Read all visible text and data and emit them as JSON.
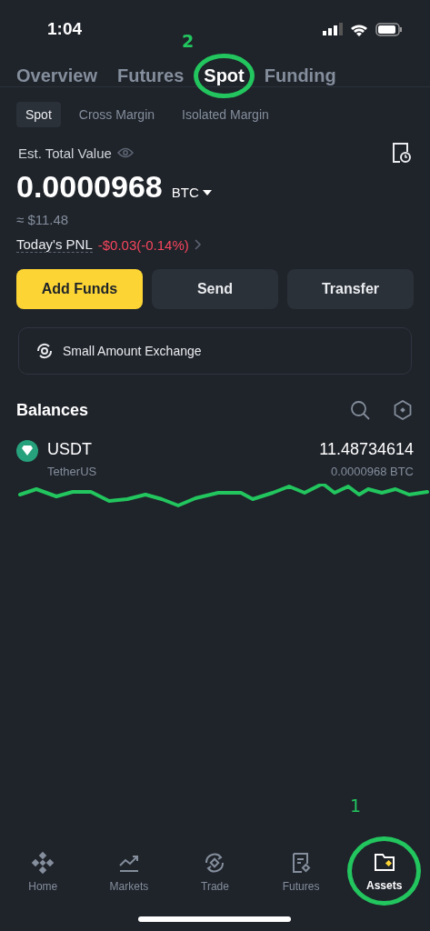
{
  "status_bar": {
    "time": "1:04"
  },
  "tabs": [
    {
      "label": "Overview",
      "selected": false,
      "circled": false
    },
    {
      "label": "Futures",
      "selected": false,
      "circled": false
    },
    {
      "label": "Spot",
      "selected": true,
      "circled": true,
      "note": "2"
    },
    {
      "label": "Funding",
      "selected": false,
      "circled": false
    }
  ],
  "sub_tabs": [
    {
      "label": "Spot",
      "selected": true
    },
    {
      "label": "Cross Margin",
      "selected": false
    },
    {
      "label": "Isolated Margin",
      "selected": false
    }
  ],
  "summary": {
    "label": "Est. Total Value",
    "value": "0.0000968",
    "unit": "BTC",
    "fiat": "≈ $11.48",
    "pnl_label": "Today's PNL",
    "pnl": "-$0.03(-0.14%)"
  },
  "actions": [
    {
      "label": "Add Funds",
      "kind": "primary"
    },
    {
      "label": "Send",
      "kind": "secondary"
    },
    {
      "label": "Transfer",
      "kind": "secondary"
    }
  ],
  "exchange_banner": {
    "label": "Small Amount Exchange"
  },
  "balances": {
    "title": "Balances",
    "assets": [
      {
        "symbol": "USDT",
        "name": "TetherUS",
        "amount": "11.48734614",
        "btc_value": "0.0000968 BTC",
        "underlined": true
      }
    ]
  },
  "bottom_nav": [
    {
      "label": "Home",
      "kind": "home",
      "selected": false,
      "circled": false
    },
    {
      "label": "Markets",
      "kind": "markets",
      "selected": false,
      "circled": false
    },
    {
      "label": "Trade",
      "kind": "trade",
      "selected": false,
      "circled": false
    },
    {
      "label": "Futures",
      "kind": "futures",
      "selected": false,
      "circled": false
    },
    {
      "label": "Assets",
      "kind": "assets",
      "selected": true,
      "circled": true,
      "note": "1"
    }
  ]
}
